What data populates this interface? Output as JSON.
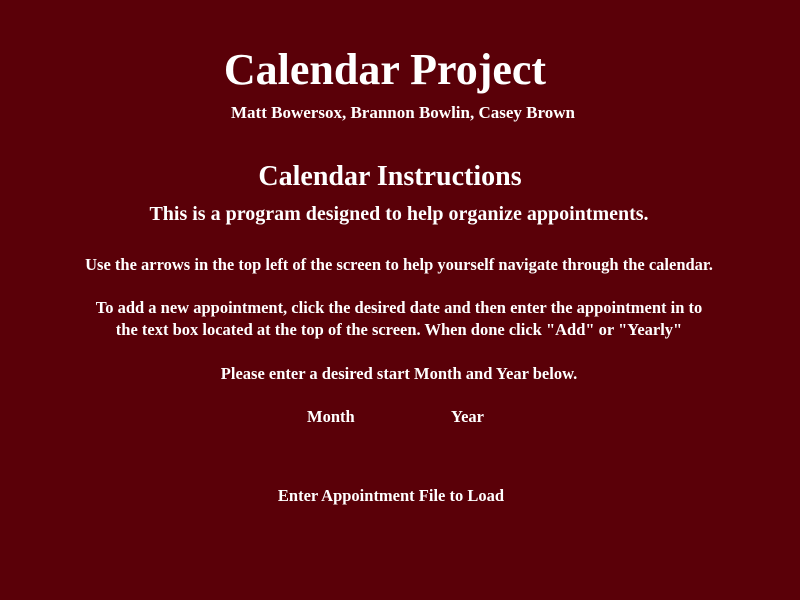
{
  "header": {
    "title": "Calendar Project",
    "authors": "Matt Bowersox, Brannon Bowlin, Casey Brown"
  },
  "instructions": {
    "heading": "Calendar Instructions",
    "intro": "This is a program designed to help organize appointments.",
    "navigate": "Use the arrows in the top left of the screen to help yourself navigate through the calendar.",
    "add_line1": "To add a new appointment, click the desired date and then enter the appointment in to",
    "add_line2": "the text box located at the top of the screen. When done click \"Add\" or \"Yearly\"",
    "enter_start": "Please enter a desired start Month and Year below."
  },
  "start_form": {
    "month_label": "Month",
    "year_label": "Year"
  },
  "file_load": {
    "label": "Enter Appointment File to Load"
  },
  "colors": {
    "background": "#5a0008",
    "text": "#ffffff"
  }
}
